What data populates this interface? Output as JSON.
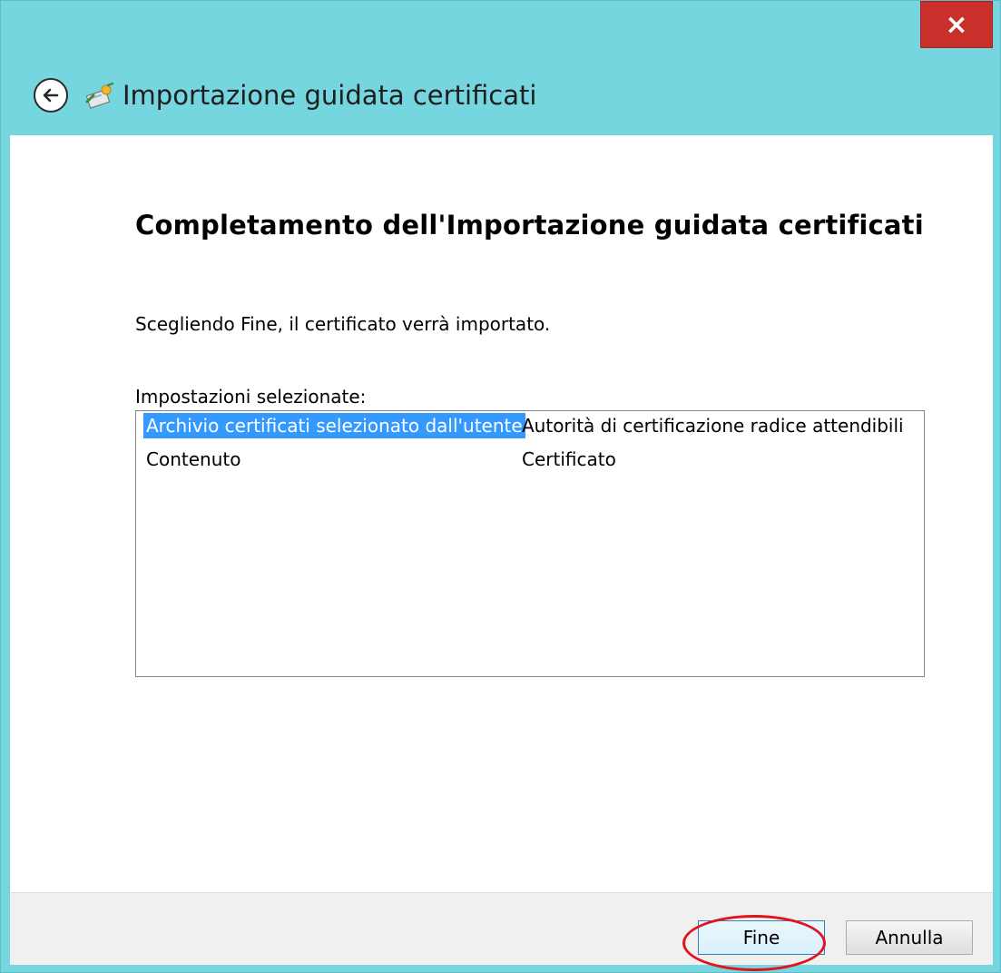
{
  "window": {
    "title": "Importazione guidata certificati",
    "close_label": "×"
  },
  "page": {
    "heading": "Completamento dell'Importazione guidata certificati",
    "intro": "Scegliendo Fine, il certificato verrà importato.",
    "settings_label": "Impostazioni selezionate:",
    "settings": [
      {
        "name": "Archivio certificati selezionato dall'utente",
        "value": "Autorità di certificazione radice attendibili",
        "selected": true
      },
      {
        "name": "Contenuto",
        "value": "Certificato",
        "selected": false
      }
    ]
  },
  "footer": {
    "finish_label": "Fine",
    "cancel_label": "Annulla"
  },
  "colors": {
    "titlebar": "#76d6df",
    "close": "#c9302c",
    "selection": "#3399ff",
    "annotation": "#e0141e"
  },
  "icons": [
    "back-arrow-icon",
    "certificate-wizard-icon",
    "close-icon"
  ]
}
